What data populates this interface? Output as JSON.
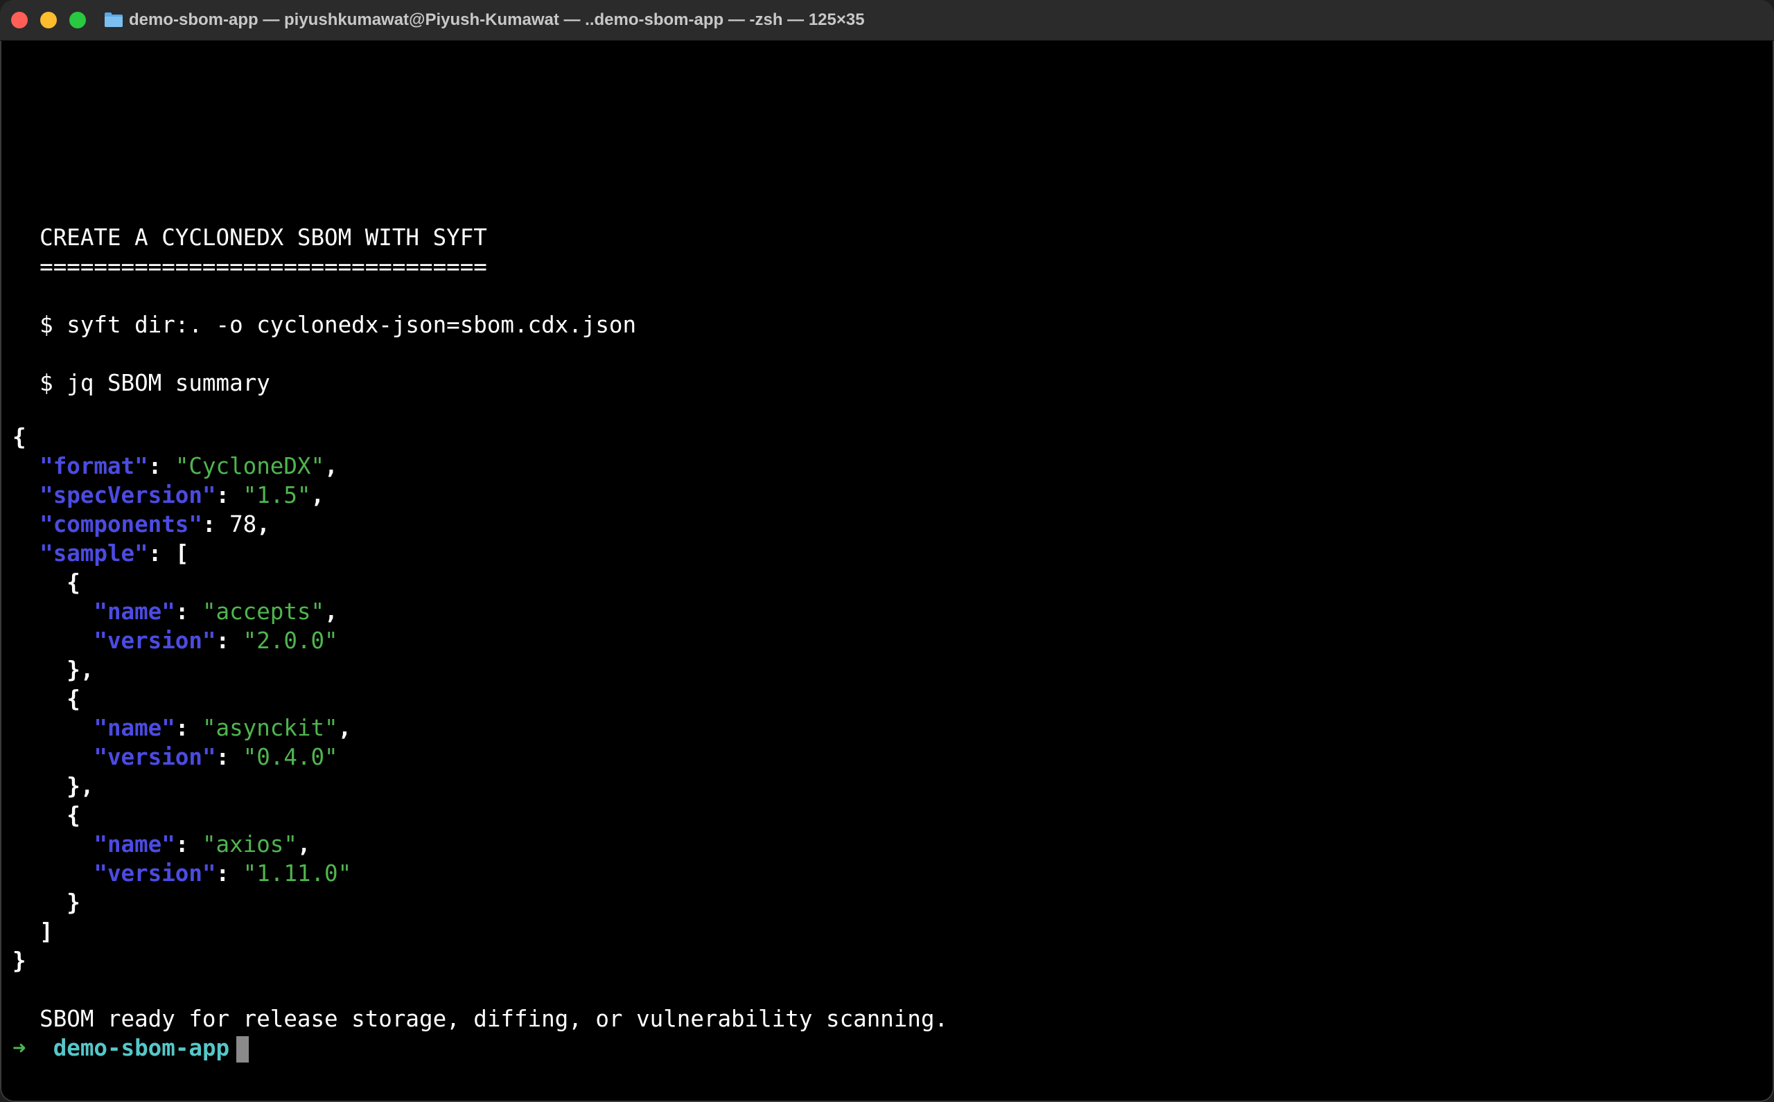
{
  "window": {
    "title": "demo-sbom-app — piyushkumawat@Piyush-Kumawat — ..demo-sbom-app — -zsh — 125×35"
  },
  "terminal": {
    "heading": "  CREATE A CYCLONEDX SBOM WITH SYFT",
    "underline": "  =================================",
    "cmd1": "  $ syft dir:. -o cyclonedx-json=sbom.cdx.json",
    "cmd2": "  $ jq SBOM summary",
    "json": {
      "open_brace": "{",
      "close_brace": "}",
      "format_key": "\"format\"",
      "format_val": "\"CycloneDX\"",
      "spec_key": "\"specVersion\"",
      "spec_val": "\"1.5\"",
      "components_key": "\"components\"",
      "components_val": "78",
      "sample_key": "\"sample\"",
      "sample": [
        {
          "name_key": "\"name\"",
          "name_val": "\"accepts\"",
          "version_key": "\"version\"",
          "version_val": "\"2.0.0\""
        },
        {
          "name_key": "\"name\"",
          "name_val": "\"asynckit\"",
          "version_key": "\"version\"",
          "version_val": "\"0.4.0\""
        },
        {
          "name_key": "\"name\"",
          "name_val": "\"axios\"",
          "version_key": "\"version\"",
          "version_val": "\"1.11.0\""
        }
      ]
    },
    "status": "  SBOM ready for release storage, diffing, or vulnerability scanning.",
    "prompt_arrow": "➜",
    "prompt_dir": "demo-sbom-app"
  },
  "colors": {
    "background": "#000000",
    "json_key": "#4b4be2",
    "json_string": "#4fb54f",
    "prompt_dir": "#55c7c9",
    "close": "#ff5f57",
    "minimize": "#febc2e",
    "maximize": "#28c840"
  },
  "icons": [
    "close-icon",
    "minimize-icon",
    "maximize-icon",
    "folder-icon"
  ]
}
